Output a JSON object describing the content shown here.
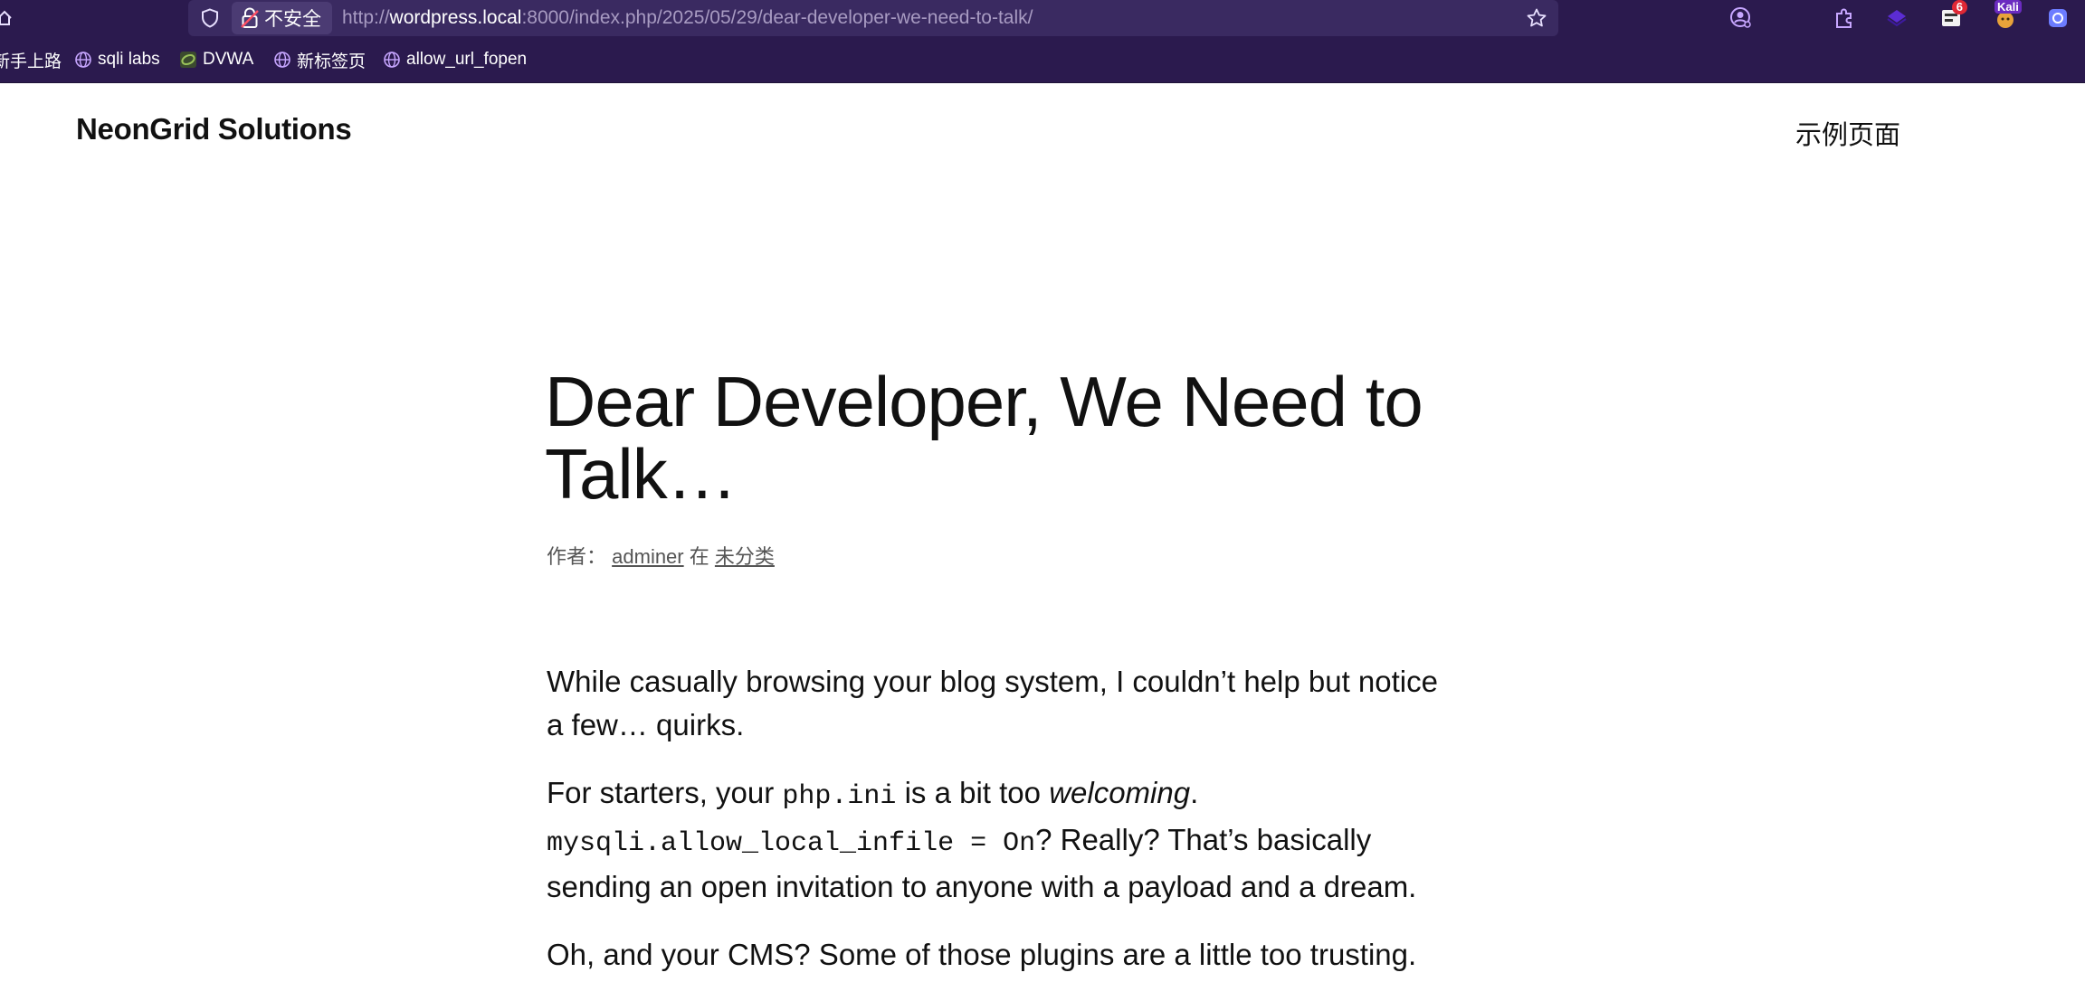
{
  "browser": {
    "security_label": "不安全",
    "url": {
      "scheme": "http://",
      "host": "wordpress.local",
      "rest": ":8000/index.php/2025/05/29/dear-developer-we-need-to-talk/"
    },
    "extensions": {
      "badge_count": "6",
      "kali_label": "Kali"
    },
    "bookmarks": [
      {
        "label": "新手上路",
        "icon": "none"
      },
      {
        "label": "sqli labs",
        "icon": "globe-icon"
      },
      {
        "label": "DVWA",
        "icon": "dvwa-logo-icon"
      },
      {
        "label": "新标签页",
        "icon": "globe-icon"
      },
      {
        "label": "allow_url_fopen",
        "icon": "globe-icon"
      }
    ]
  },
  "site": {
    "title": "NeonGrid Solutions",
    "nav": [
      "示例页面"
    ]
  },
  "post": {
    "title": "Dear Developer, We Need to Talk…",
    "meta": {
      "author_prefix": "作者：",
      "author": "adminer",
      "in_word": "在",
      "category": "未分类"
    },
    "paragraphs": {
      "p1": "While casually browsing your blog system, I couldn’t help but notice a few… quirks.",
      "p2_a": "For starters, your ",
      "p2_code1": "php.ini",
      "p2_b": " is a bit too ",
      "p2_em": "welcoming",
      "p2_c": ".",
      "p2_code2": "mysqli.allow_local_infile = On",
      "p2_d": "? Really? That’s basically sending an open invitation to anyone with a payload and a dream.",
      "p3": "Oh, and your CMS? Some of those plugins are a little too trusting."
    }
  },
  "colors": {
    "chrome_bg": "#2b1a4e",
    "urlbar_bg": "#3a2a61",
    "page_bg": "#ffffff",
    "text": "#111111"
  }
}
